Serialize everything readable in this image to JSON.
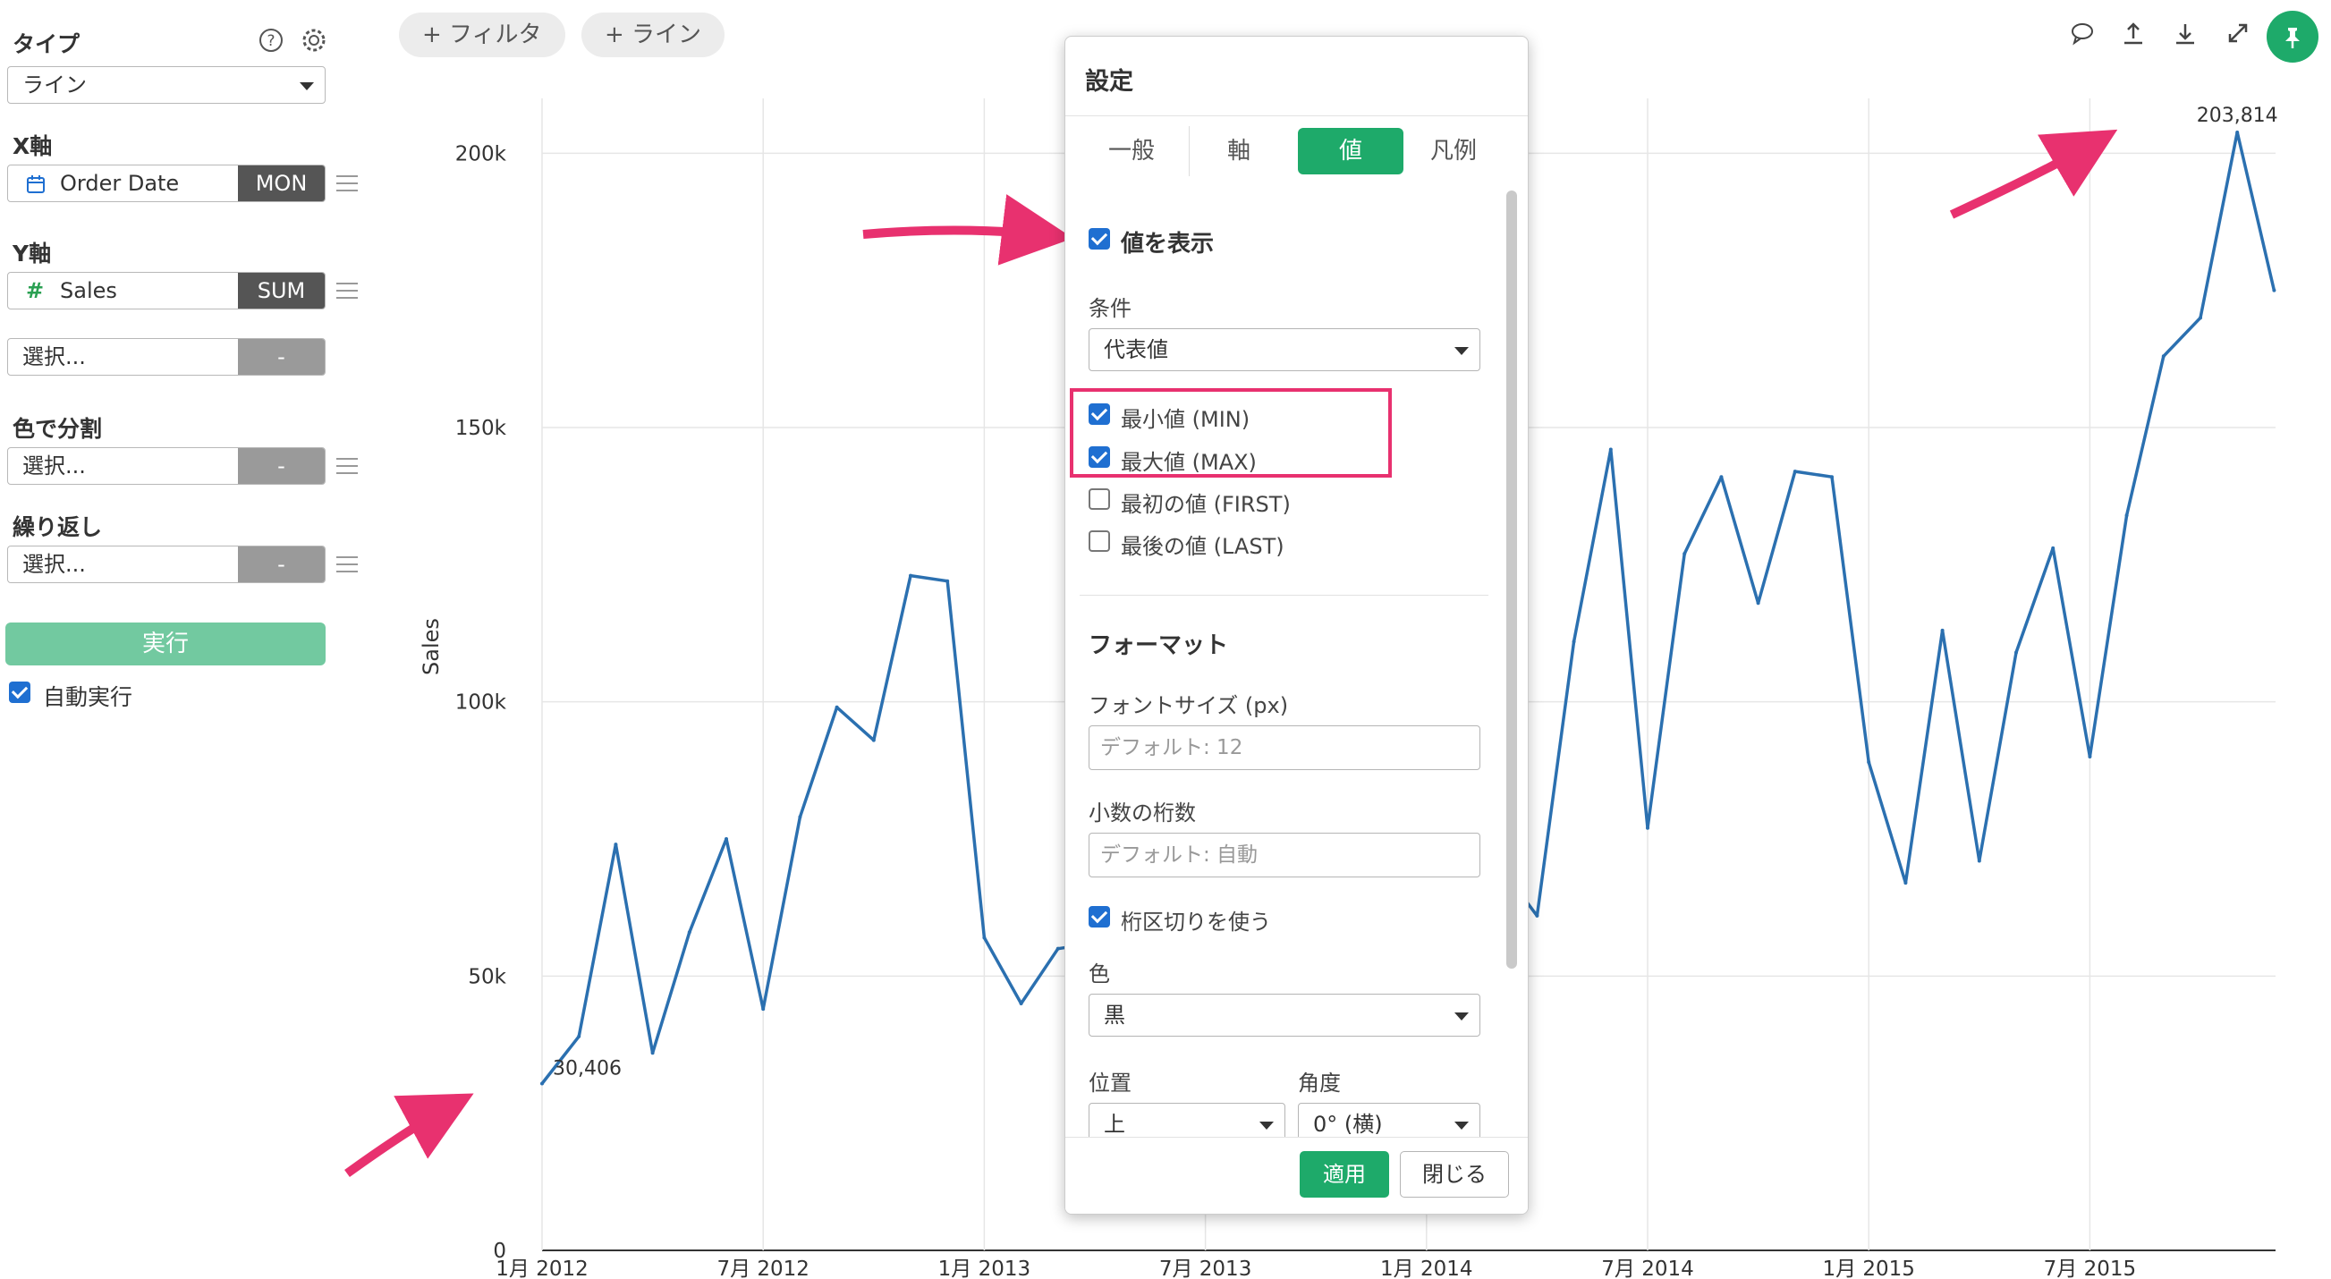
{
  "left_panel": {
    "type_label": "タイプ",
    "type_value": "ライン",
    "x_axis_label": "X軸",
    "x_field": "Order Date",
    "x_agg": "MON",
    "y_axis_label": "Y軸",
    "y_field": "Sales",
    "y_agg": "SUM",
    "y_extra_placeholder": "選択...",
    "y_extra_agg": "-",
    "color_split_label": "色で分割",
    "color_split_placeholder": "選択...",
    "color_split_agg": "-",
    "repeat_label": "繰り返し",
    "repeat_placeholder": "選択...",
    "repeat_agg": "-",
    "run_button": "実行",
    "auto_run_label": "自動実行",
    "auto_run_checked": true,
    "icons": [
      "help-icon",
      "gear-icon",
      "calendar-icon",
      "hash-icon",
      "drag-handle-icon"
    ]
  },
  "toolbar": {
    "add_filter": "+ フィルタ",
    "add_line": "+ ライン",
    "icons": [
      "comment-icon",
      "upload-icon",
      "download-icon",
      "expand-icon",
      "pin-icon"
    ]
  },
  "chart_data": {
    "type": "line",
    "ylabel": "Sales",
    "ylim": [
      0,
      210000
    ],
    "yticks": [
      0,
      50000,
      100000,
      150000,
      200000
    ],
    "ytick_labels": [
      "0",
      "50k",
      "100k",
      "150k",
      "200k"
    ],
    "xtick_labels": [
      "1月 2012",
      "7月 2012",
      "1月 2013",
      "7月 2013",
      "1月 2014",
      "7月 2014",
      "1月 2015",
      "7月 2015"
    ],
    "x": [
      "2012-01",
      "2012-02",
      "2012-03",
      "2012-04",
      "2012-05",
      "2012-06",
      "2012-07",
      "2012-08",
      "2012-09",
      "2012-10",
      "2012-11",
      "2012-12",
      "2013-01",
      "2013-02",
      "2013-03",
      "2013-04",
      "2013-05",
      "2013-06",
      "2013-07",
      "2013-08",
      "2013-09",
      "2013-10",
      "2013-11",
      "2013-12",
      "2014-01",
      "2014-02",
      "2014-03",
      "2014-04",
      "2014-05",
      "2014-06",
      "2014-07",
      "2014-08",
      "2014-09",
      "2014-10",
      "2014-11",
      "2014-12",
      "2015-01",
      "2015-02",
      "2015-03",
      "2015-04",
      "2015-05",
      "2015-06",
      "2015-07",
      "2015-08",
      "2015-09",
      "2015-10",
      "2015-11",
      "2015-12"
    ],
    "series": [
      {
        "values": [
          30406,
          39000,
          74000,
          36000,
          58000,
          75000,
          44000,
          79000,
          99000,
          93000,
          123000,
          122000,
          57000,
          45000,
          55000,
          56000,
          80000,
          82000,
          96000,
          78000,
          104000,
          103000,
          109000,
          93000,
          80000,
          82000,
          70000,
          61000,
          111000,
          146000,
          77000,
          127000,
          141000,
          118000,
          142000,
          141000,
          89000,
          67000,
          113000,
          71000,
          109000,
          128000,
          90000,
          134000,
          163000,
          170000,
          203814,
          175000
        ]
      }
    ],
    "color": "#2b70b0",
    "value_labels": [
      {
        "text": "30,406",
        "point": "min"
      },
      {
        "text": "203,814",
        "point": "max"
      }
    ],
    "grid": true
  },
  "settings_modal": {
    "title": "設定",
    "tabs": [
      "一般",
      "軸",
      "値",
      "凡例"
    ],
    "active_tab": "値",
    "show_values_label": "値を表示",
    "show_values_checked": true,
    "condition_label": "条件",
    "condition_value": "代表値",
    "options": [
      {
        "label": "最小値 (MIN)",
        "checked": true
      },
      {
        "label": "最大値 (MAX)",
        "checked": true
      },
      {
        "label": "最初の値 (FIRST)",
        "checked": false
      },
      {
        "label": "最後の値 (LAST)",
        "checked": false
      }
    ],
    "format_heading": "フォーマット",
    "font_size_label": "フォントサイズ (px)",
    "font_size_placeholder": "デフォルト: 12",
    "decimals_label": "小数の桁数",
    "decimals_placeholder": "デフォルト: 自動",
    "thousands_sep_label": "桁区切りを使う",
    "thousands_sep_checked": true,
    "color_label": "色",
    "color_value": "黒",
    "position_label": "位置",
    "position_value": "上",
    "angle_label": "角度",
    "angle_value": "0° (横)",
    "apply_button": "適用",
    "close_button": "閉じる"
  },
  "colors": {
    "accent": "#1eaa6a",
    "run_button": "#72c9a0",
    "annotation": "#e8316f",
    "line": "#2b70b0"
  }
}
